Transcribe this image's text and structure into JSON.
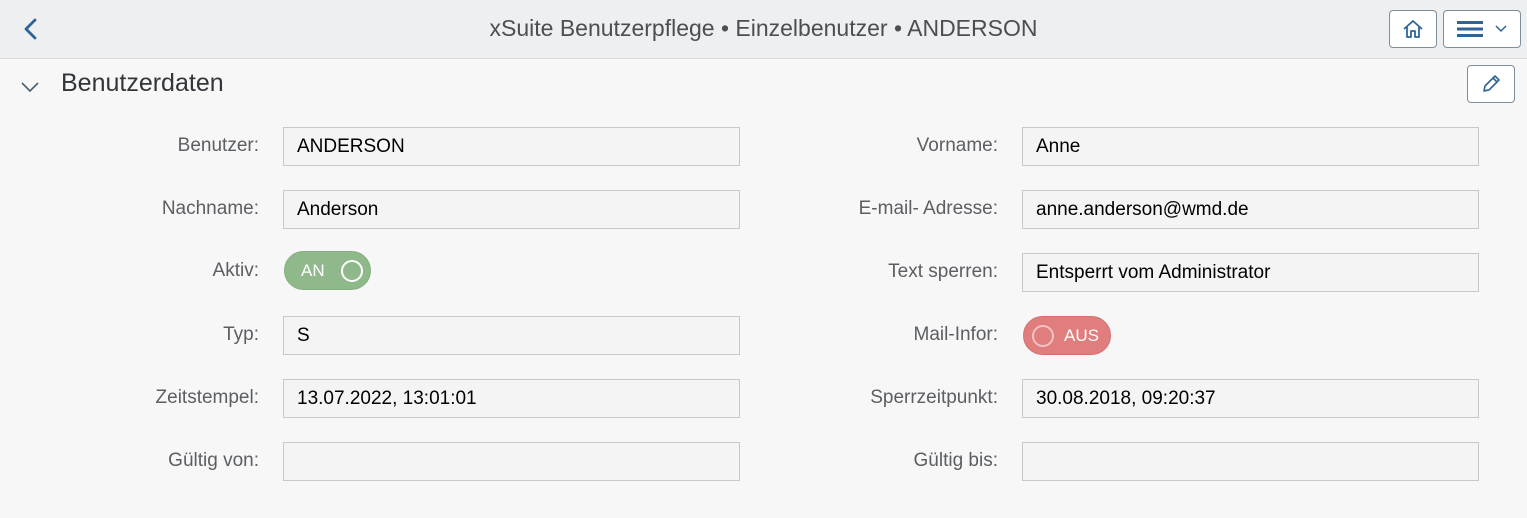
{
  "shell": {
    "title": "xSuite Benutzerpflege • Einzelbenutzer • ANDERSON"
  },
  "section": {
    "title": "Benutzerdaten"
  },
  "form": {
    "benutzer": {
      "label": "Benutzer:",
      "value": "ANDERSON"
    },
    "vorname": {
      "label": "Vorname:",
      "value": "Anne"
    },
    "nachname": {
      "label": "Nachname:",
      "value": "Anderson"
    },
    "email": {
      "label": "E-mail- Adresse:",
      "value": "anne.anderson@wmd.de"
    },
    "aktiv": {
      "label": "Aktiv:",
      "state_text": "AN",
      "on": true
    },
    "text_sperren": {
      "label": "Text sperren:",
      "value": "Entsperrt vom Administrator"
    },
    "typ": {
      "label": "Typ:",
      "value": "S"
    },
    "mail_infor": {
      "label": "Mail-Infor:",
      "state_text": "AUS",
      "on": false
    },
    "zeitstempel": {
      "label": "Zeitstempel:",
      "value": "13.07.2022, 13:01:01"
    },
    "sperrzeitpunkt": {
      "label": "Sperrzeitpunkt:",
      "value": "30.08.2018, 09:20:37"
    },
    "gueltig_von": {
      "label": "Gültig von:",
      "value": ""
    },
    "gueltig_bis": {
      "label": "Gültig bis:",
      "value": ""
    }
  },
  "icons": {
    "back": "chevron-left-icon",
    "home": "home-icon",
    "menu": "hamburger-menu-icon",
    "menu_dropdown": "chevron-down-icon",
    "collapse": "chevron-down-icon",
    "edit": "pencil-icon"
  },
  "colors": {
    "accent": "#2f6497",
    "switch_on": "#8fb98a",
    "switch_off": "#e07e7e",
    "shell_bg": "#edeff0",
    "page_bg": "#f7f7f7"
  }
}
